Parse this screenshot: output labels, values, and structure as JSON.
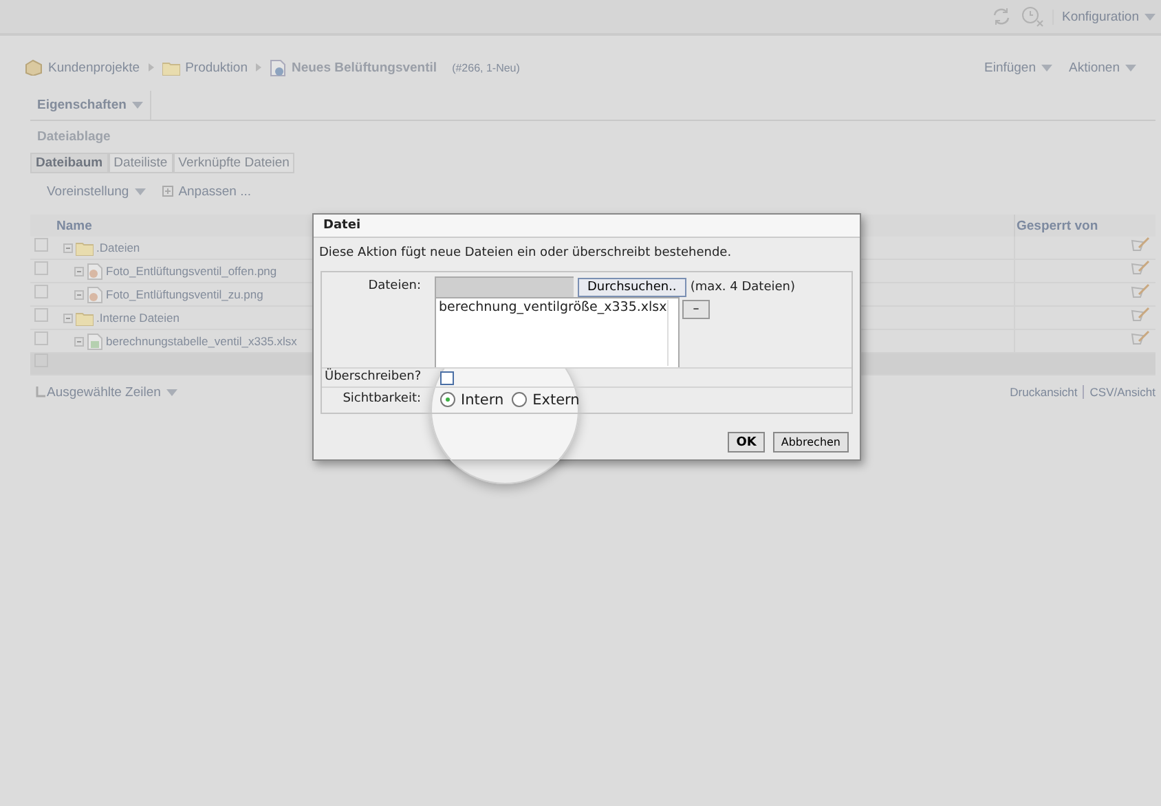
{
  "top_bar": {
    "menu": "Konfiguration"
  },
  "breadcrumb": [
    {
      "label": "Kundenprojekte",
      "kind": "project"
    },
    {
      "label": "Produktion",
      "kind": "folder"
    },
    {
      "label": "Neues Belüftungsventil",
      "kind": "document"
    }
  ],
  "breadcrumb_note": "(#266, 1-Neu)",
  "actions": [
    "Einfügen",
    "Aktionen"
  ],
  "main_tab": "Eigenschaften",
  "section_title": "Dateiablage",
  "subtabs": [
    {
      "label": "Dateibaum",
      "selected": true
    },
    {
      "label": "Dateiliste",
      "selected": false
    },
    {
      "label": "Verknüpfte Dateien",
      "selected": false
    }
  ],
  "toolbar": {
    "preset": "Voreinstellung",
    "customize": "Anpassen ..."
  },
  "table": {
    "columns": [
      {
        "label": "Name"
      },
      {
        "label": "Gesperrt von"
      }
    ],
    "rows": [
      {
        "name": ".Dateien",
        "kind": "folder",
        "checked": false,
        "children": [
          {
            "name": "Foto_Entlüftungsventil_offen.png",
            "kind": "image",
            "checked": false
          },
          {
            "name": "Foto_Entlüftungsventil_zu.png",
            "kind": "image",
            "checked": false
          }
        ]
      },
      {
        "name": ".Interne Dateien",
        "kind": "folder",
        "checked": false,
        "children": [
          {
            "name": "berechnungstabelle_ventil_x335.xlsx",
            "kind": "sheet",
            "checked": false
          }
        ]
      }
    ],
    "empty_row": {
      "checked": false
    }
  },
  "footer": {
    "selected_rows": "Ausgewählte Zeilen",
    "links": [
      "Druckansicht",
      "CSV/Ansicht"
    ]
  },
  "dialog": {
    "title": "Datei",
    "description": "Diese Aktion fügt neue Dateien ein oder überschreibt bestehende.",
    "files_label": "Dateien:",
    "browse_button": "Durchsuchen..",
    "max_note": "(max. 4 Dateien)",
    "file_list": [
      "berechnung_ventilgröße_x335.xlsx"
    ],
    "remove_button": "–",
    "overwrite": {
      "label": "Überschreiben?",
      "checked": false
    },
    "visibility": {
      "label": "Sichtbarkeit:",
      "options": [
        {
          "label": "Intern",
          "selected": true
        },
        {
          "label": "Extern",
          "selected": false
        }
      ]
    },
    "buttons": [
      "OK",
      "Abbrechen"
    ]
  }
}
